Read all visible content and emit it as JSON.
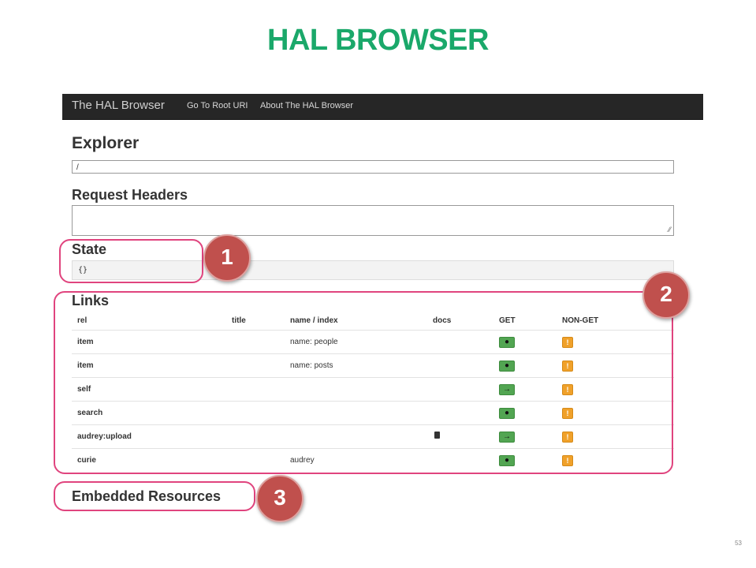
{
  "slide": {
    "title": "HAL BROWSER",
    "page_number": "53"
  },
  "topbar": {
    "brand": "The HAL Browser",
    "nav": [
      "Go To Root URI",
      "About The HAL Browser"
    ]
  },
  "explorer": {
    "heading": "Explorer",
    "url_value": "/"
  },
  "request_headers": {
    "heading": "Request Headers",
    "value": ""
  },
  "state": {
    "heading": "State",
    "value": "{}"
  },
  "links": {
    "heading": "Links",
    "columns": [
      "rel",
      "title",
      "name / index",
      "docs",
      "GET",
      "NON-GET"
    ],
    "rows": [
      {
        "rel": "item",
        "title": "",
        "name": "name: people",
        "docs": false,
        "get_icon": "circle-icon",
        "get_glyph": "●",
        "nonget_glyph": "!"
      },
      {
        "rel": "item",
        "title": "",
        "name": "name: posts",
        "docs": false,
        "get_icon": "circle-icon",
        "get_glyph": "●",
        "nonget_glyph": "!"
      },
      {
        "rel": "self",
        "title": "",
        "name": "",
        "docs": false,
        "get_icon": "arrow-right-icon",
        "get_glyph": "→",
        "nonget_glyph": "!"
      },
      {
        "rel": "search",
        "title": "",
        "name": "",
        "docs": false,
        "get_icon": "circle-icon",
        "get_glyph": "●",
        "nonget_glyph": "!"
      },
      {
        "rel": "audrey:upload",
        "title": "",
        "name": "",
        "docs": true,
        "get_icon": "arrow-right-icon",
        "get_glyph": "→",
        "nonget_glyph": "!"
      },
      {
        "rel": "curie",
        "title": "",
        "name": "audrey",
        "docs": false,
        "get_icon": "circle-icon",
        "get_glyph": "●",
        "nonget_glyph": "!"
      }
    ]
  },
  "embedded": {
    "heading": "Embedded Resources"
  },
  "callouts": [
    "1",
    "2",
    "3"
  ],
  "colors": {
    "title_green": "#1aa86a",
    "callout_pink": "#e0447e",
    "badge_red": "#c0504d",
    "get_green": "#52a552",
    "nonget_orange": "#f0a12a",
    "navbar_dark": "#262626"
  }
}
